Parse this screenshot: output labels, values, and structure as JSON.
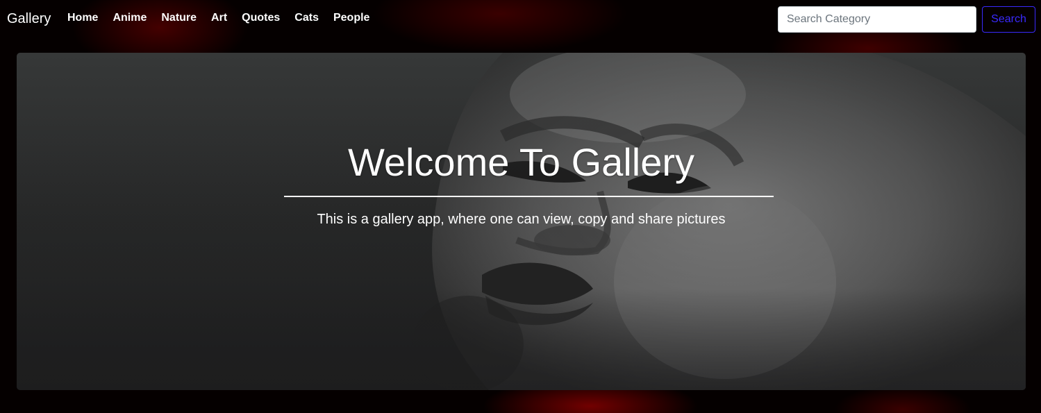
{
  "navbar": {
    "brand": "Gallery",
    "links": [
      {
        "label": "Home"
      },
      {
        "label": "Anime"
      },
      {
        "label": "Nature"
      },
      {
        "label": "Art"
      },
      {
        "label": "Quotes"
      },
      {
        "label": "Cats"
      },
      {
        "label": "People"
      }
    ],
    "search": {
      "placeholder": "Search Category",
      "value": "",
      "button_label": "Search"
    }
  },
  "hero": {
    "title": "Welcome To Gallery",
    "lead": "This is a gallery app, where one can view, copy and share pictures"
  },
  "colors": {
    "background": "#000000",
    "accent_red": "#8b0000",
    "search_button": "#3a2aff",
    "hero_panel": "#2a2b2b",
    "text": "#ffffff"
  }
}
